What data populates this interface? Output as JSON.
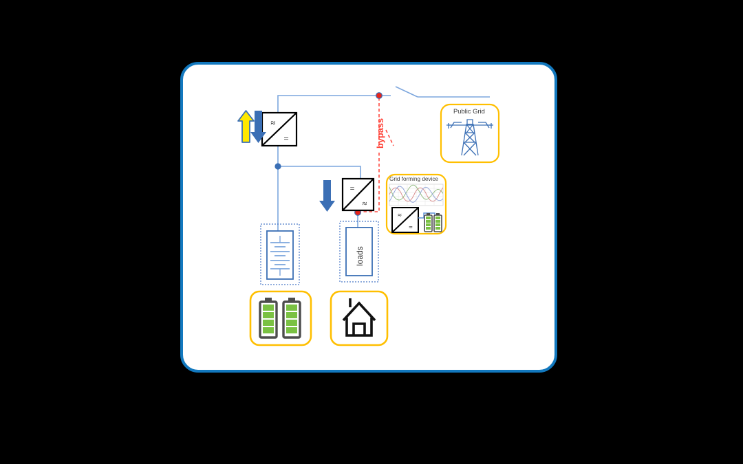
{
  "diagram": {
    "title": "Microgrid with grid forming device and bypass",
    "canvas": {
      "background": "#000000",
      "card_background": "#ffffff",
      "card_border_color": "#1278be"
    },
    "labels": {
      "bypass": "bypass",
      "public_grid": "Public Grid",
      "grid_forming_device": "Grid forming device",
      "loads": "loads"
    },
    "nodes": [
      {
        "id": "converter-ac-dc",
        "name": "AC/DC converter",
        "top_symbol": "≈",
        "bottom_symbol": "="
      },
      {
        "id": "converter-dc-ac",
        "name": "DC/AC converter",
        "top_symbol": "=",
        "bottom_symbol": "≈"
      },
      {
        "id": "battery-source",
        "name": "DC battery source symbol"
      },
      {
        "id": "loads-block",
        "name": "loads block"
      },
      {
        "id": "public-grid",
        "name": "Public Grid pylon"
      },
      {
        "id": "grid-forming-device",
        "name": "Grid forming device"
      },
      {
        "id": "battery-bank-icon",
        "name": "Battery bank icon"
      },
      {
        "id": "house-icon",
        "name": "House icon"
      }
    ],
    "arrows": [
      {
        "id": "arrow-up-yellow",
        "direction": "up",
        "fill": "#ffe800",
        "stroke": "#3b6fb5"
      },
      {
        "id": "arrow-down-blue-1",
        "direction": "down",
        "fill": "#3b6fb5"
      },
      {
        "id": "arrow-down-blue-2",
        "direction": "down",
        "fill": "#3b6fb5"
      }
    ],
    "colors": {
      "wire": "#7ca6dd",
      "wire_dark": "#3b6fb5",
      "bypass": "#ff3b30",
      "accent_yellow": "#ffbf00",
      "battery_green": "#7ac143",
      "battery_body": "#4d4d4d",
      "card_border": "#1278be"
    },
    "switches": [
      {
        "id": "grid-switch",
        "state": "open",
        "color": "#7ca6dd"
      },
      {
        "id": "bypass-switch",
        "state": "open",
        "color": "#ff3b30"
      }
    ],
    "junctions": [
      {
        "id": "junction-bypass-top",
        "color": "#ff0000"
      },
      {
        "id": "junction-bypass-bottom",
        "color": "#ff0000"
      },
      {
        "id": "junction-dc-bus",
        "color": "#3b6fb5"
      }
    ],
    "waveform": {
      "id": "three-phase-waveform",
      "phases": [
        "phase-a",
        "phase-b",
        "phase-c"
      ],
      "colors": [
        "#d98c8c",
        "#8cb87a",
        "#8c9fd6"
      ]
    }
  }
}
